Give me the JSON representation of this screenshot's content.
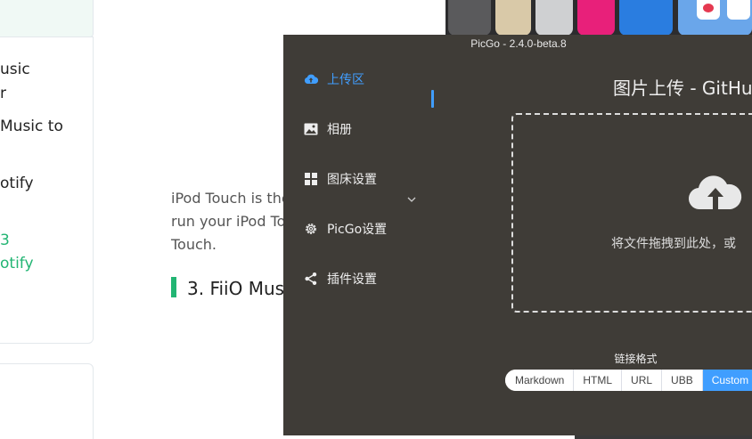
{
  "background": {
    "toc_items": [
      "usic",
      "r",
      "Music to",
      "otify",
      "3",
      "otify"
    ],
    "paragraph_lines": [
      "iPod Touch is the",
      "run your iPod To",
      "Touch."
    ],
    "heading": "3. FiiO Mus",
    "colors": {
      "accent": "#22b573"
    }
  },
  "window": {
    "title": "PicGo - 2.4.0-beta.8",
    "sidebar": {
      "items": [
        {
          "label": "上传区",
          "icon": "cloud-upload-icon",
          "active": true
        },
        {
          "label": "相册",
          "icon": "image-icon"
        },
        {
          "label": "图床设置",
          "icon": "grid-icon",
          "expandable": true
        },
        {
          "label": "PicGo设置",
          "icon": "gear-icon"
        },
        {
          "label": "插件设置",
          "icon": "share-icon"
        }
      ]
    },
    "main": {
      "title": "图片上传 - GitHub",
      "drop_text": "将文件拖拽到此处，或",
      "link_format_label": "链接格式",
      "link_formats": [
        "Markdown",
        "HTML",
        "URL",
        "UBB",
        "Custom"
      ],
      "selected_format": "Custom"
    },
    "colors": {
      "background": "#3f3c37",
      "accent": "#409eff"
    }
  }
}
